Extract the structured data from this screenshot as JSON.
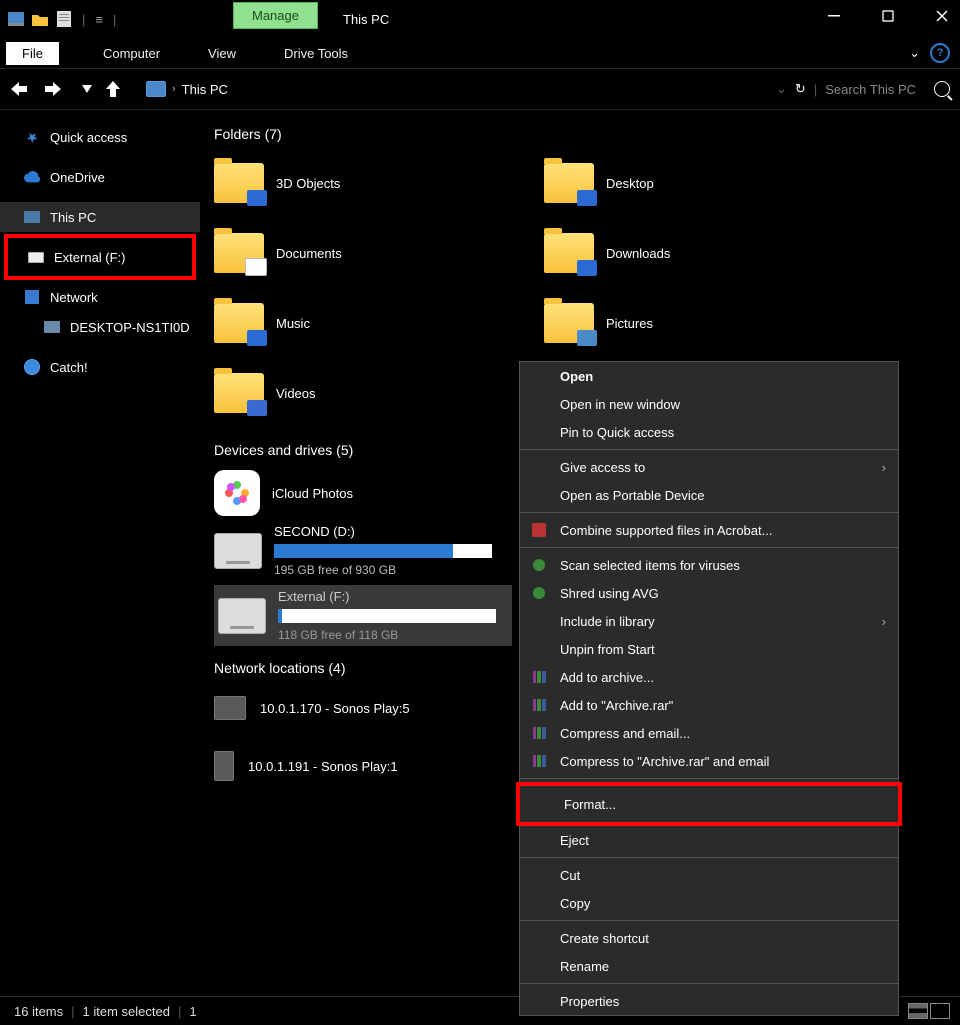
{
  "title": "This PC",
  "titlebar": {
    "manage": "Manage"
  },
  "ribbon": {
    "file": "File",
    "computer": "Computer",
    "view": "View",
    "drive_tools": "Drive Tools"
  },
  "breadcrumb": {
    "location": "This PC"
  },
  "search": {
    "placeholder": "Search This PC"
  },
  "nav_right": {
    "refresh": "⟳",
    "text": "Search This PC"
  },
  "sidebar": {
    "quick_access": "Quick access",
    "onedrive": "OneDrive",
    "this_pc": "This PC",
    "external": "External (F:)",
    "network": "Network",
    "desktop_node": "DESKTOP-NS1TI0D",
    "catch": "Catch!"
  },
  "sections": {
    "folders": "Folders (7)",
    "devices": "Devices and drives (5)",
    "network": "Network locations (4)"
  },
  "folders": [
    {
      "name": "3D Objects",
      "badge": "fb-3d"
    },
    {
      "name": "Desktop",
      "badge": "fb-desk"
    },
    {
      "name": "Documents",
      "badge": "fb-doc"
    },
    {
      "name": "Downloads",
      "badge": "fb-down"
    },
    {
      "name": "Music",
      "badge": "fb-mus"
    },
    {
      "name": "Pictures",
      "badge": "fb-pic"
    },
    {
      "name": "Videos",
      "badge": "fb-vid"
    }
  ],
  "drives": {
    "icloud": "iCloud Photos",
    "second_name": "SECOND (D:)",
    "second_free": "195 GB free of 930 GB",
    "second_fill_pct": 82,
    "external_name": "External (F:)",
    "external_free": "118 GB free of 118 GB",
    "external_fill_pct": 2
  },
  "network_loc": [
    "10.0.1.170 - Sonos Play:5",
    "10.0.1.191 - Sonos Play:1"
  ],
  "context": {
    "open": "Open",
    "open_new": "Open in new window",
    "pin": "Pin to Quick access",
    "give_access": "Give access to",
    "portable": "Open as Portable Device",
    "combine": "Combine supported files in Acrobat...",
    "scan": "Scan selected items for viruses",
    "shred": "Shred using AVG",
    "include": "Include in library",
    "unpin": "Unpin from Start",
    "add_archive": "Add to archive...",
    "add_archive_rar": "Add to \"Archive.rar\"",
    "compress_email": "Compress and email...",
    "compress_rar_email": "Compress to \"Archive.rar\" and email",
    "format": "Format...",
    "eject": "Eject",
    "cut": "Cut",
    "copy": "Copy",
    "shortcut": "Create shortcut",
    "rename": "Rename",
    "properties": "Properties"
  },
  "status": {
    "items": "16 items",
    "selected": "1 item selected",
    "count": "1"
  }
}
